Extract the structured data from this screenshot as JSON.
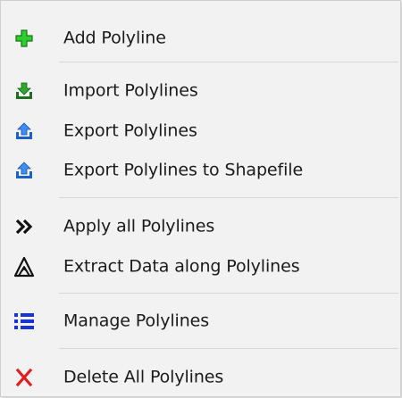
{
  "menu": {
    "items": [
      {
        "label": "Add Polyline",
        "icon": "add-icon"
      },
      {
        "label": "Import Polylines",
        "icon": "import-icon"
      },
      {
        "label": "Export Polylines",
        "icon": "export-icon"
      },
      {
        "label": "Export Polylines to Shapefile",
        "icon": "export-shapefile-icon"
      },
      {
        "label": "Apply all Polylines",
        "icon": "double-chevron-right-icon"
      },
      {
        "label": "Extract Data along Polylines",
        "icon": "extract-data-icon"
      },
      {
        "label": "Manage Polylines",
        "icon": "list-icon"
      },
      {
        "label": "Delete All Polylines",
        "icon": "delete-x-icon"
      }
    ]
  },
  "colors": {
    "menu_background": "#f2f2f2",
    "separator": "#d7d7d7",
    "add_icon_green": "#2ecc2e",
    "import_icon_green": "#1e7d1e",
    "export_icon_blue": "#1f6fe0",
    "list_icon_blue": "#1a33d6",
    "delete_icon_red": "#e02020"
  }
}
